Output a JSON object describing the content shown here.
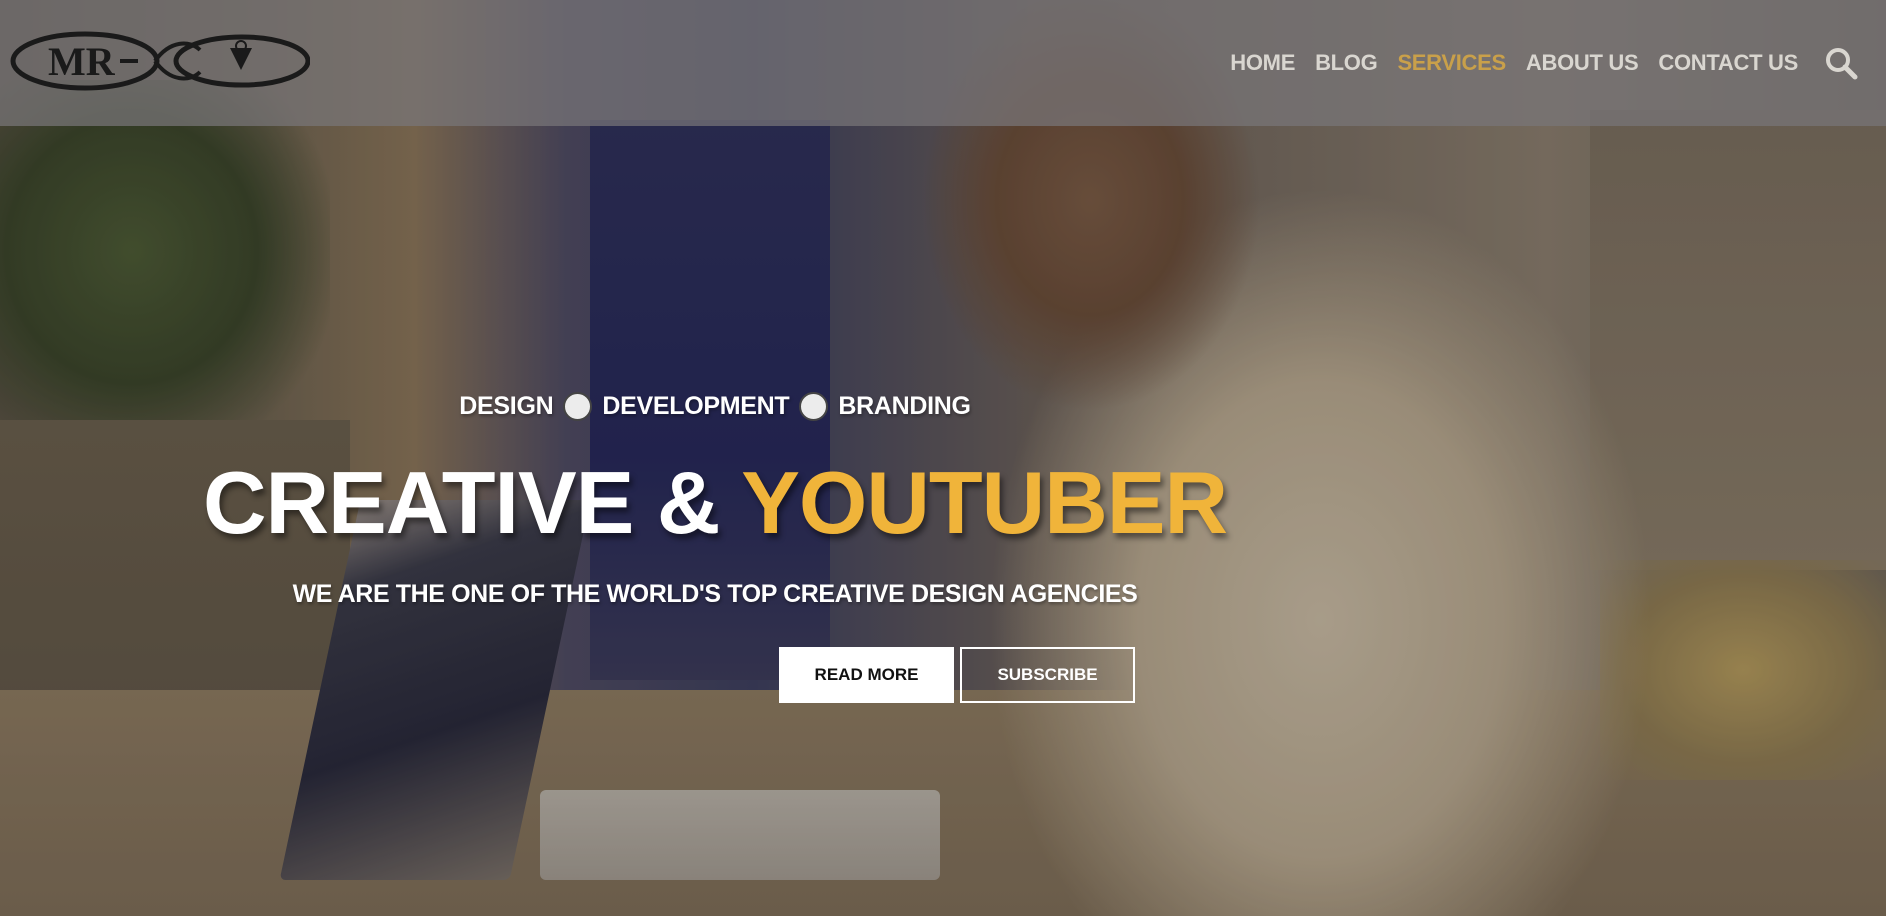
{
  "header": {
    "logo_text": "MR",
    "nav": [
      {
        "label": "HOME",
        "active": false
      },
      {
        "label": "BLOG",
        "active": false
      },
      {
        "label": "SERVICES",
        "active": true
      },
      {
        "label": "ABOUT US",
        "active": false
      },
      {
        "label": "CONTACT US",
        "active": false
      }
    ],
    "search_icon": "search-icon"
  },
  "hero": {
    "kicker": [
      "DESIGN",
      "DEVELOPMENT",
      "BRANDING"
    ],
    "headline_main": "CREATIVE & ",
    "headline_accent": "YOUTUBER",
    "subline": "WE ARE THE ONE OF THE WORLD'S TOP CREATIVE DESIGN AGENCIES",
    "buttons": {
      "read_more": "READ MORE",
      "subscribe": "SUBSCRIBE"
    }
  },
  "colors": {
    "accent": "#f0b43a",
    "nav_active": "#c9a04a",
    "nav_text": "#d9d6d0",
    "header_bg": "#787678"
  }
}
